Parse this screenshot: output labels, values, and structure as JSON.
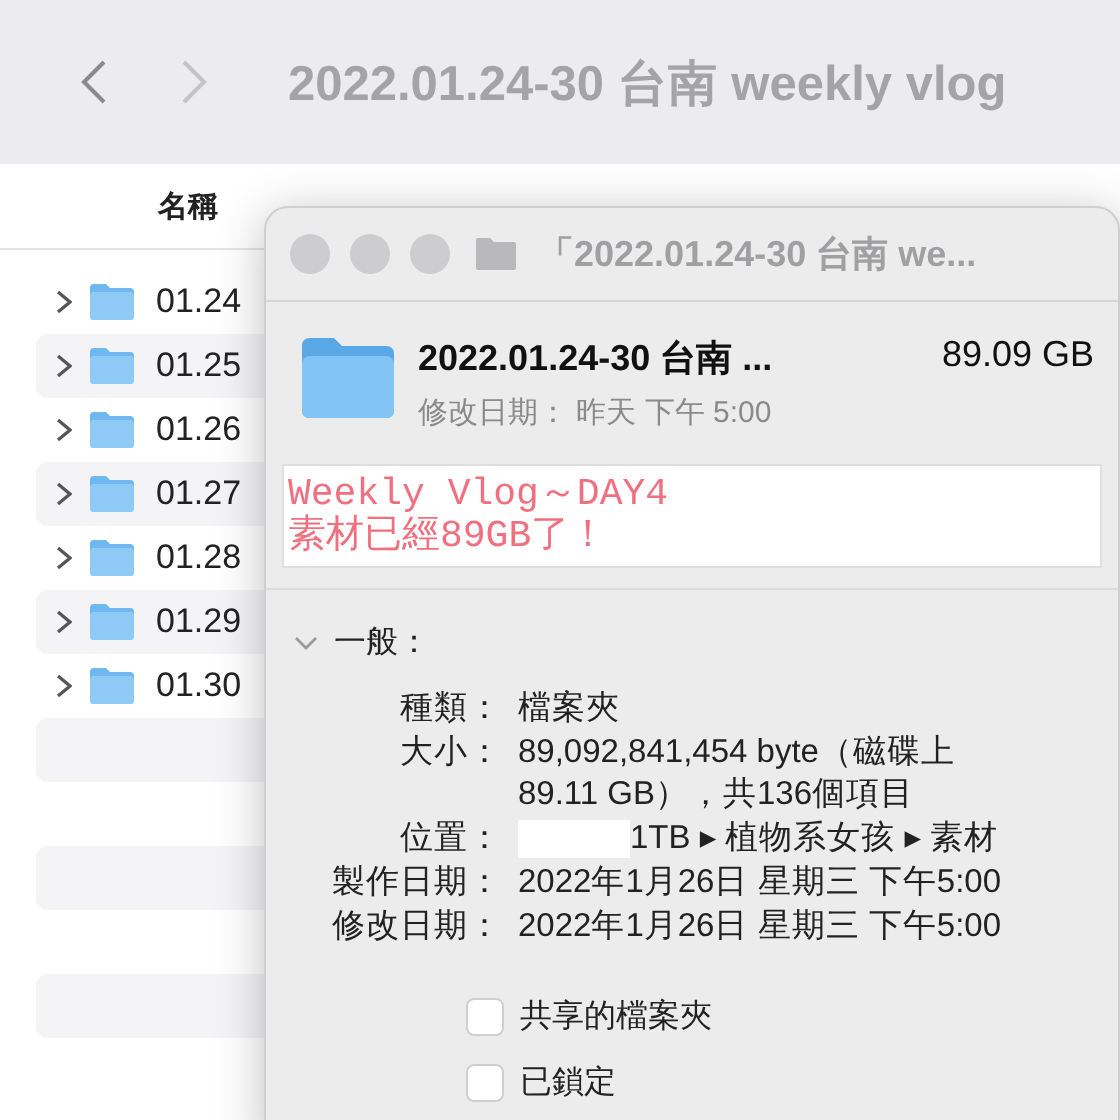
{
  "finder": {
    "title": "2022.01.24-30 台南 weekly vlog",
    "column_header": "名稱",
    "rows": [
      {
        "name": "01.24",
        "expanded": false
      },
      {
        "name": "01.25",
        "expanded": false
      },
      {
        "name": "01.26",
        "expanded": false
      },
      {
        "name": "01.27",
        "expanded": false
      },
      {
        "name": "01.28",
        "expanded": false
      },
      {
        "name": "01.29",
        "expanded": false
      },
      {
        "name": "01.30",
        "expanded": false
      }
    ]
  },
  "info_window": {
    "title": "「2022.01.24-30 台南 we...",
    "name": "2022.01.24-30 台南 ...",
    "size": "89.09 GB",
    "modified": "修改日期： 昨天 下午 5:00",
    "comments": [
      "Weekly Vlog～DAY4",
      "素材已經89GB了！"
    ],
    "section": {
      "label": "一般：",
      "expanded": true
    },
    "fields": [
      {
        "kind": "text",
        "label": "種類：",
        "lines": [
          "檔案夾"
        ]
      },
      {
        "kind": "text",
        "label": "大小：",
        "lines": [
          "89,092,841,454 byte（磁碟上",
          "89.11 GB），共136個項目"
        ]
      },
      {
        "kind": "redacted_path",
        "label": "位置：",
        "lines": [
          "1TB ▸ 植物系女孩 ▸ 素材"
        ]
      },
      {
        "kind": "text",
        "label": "製作日期：",
        "lines": [
          "2022年1月26日 星期三 下午5:00"
        ]
      },
      {
        "kind": "text",
        "label": "修改日期：",
        "lines": [
          "2022年1月26日 星期三 下午5:00"
        ]
      }
    ],
    "checkboxes": [
      {
        "label": "共享的檔案夾",
        "checked": false
      },
      {
        "label": "已鎖定",
        "checked": false
      }
    ]
  }
}
